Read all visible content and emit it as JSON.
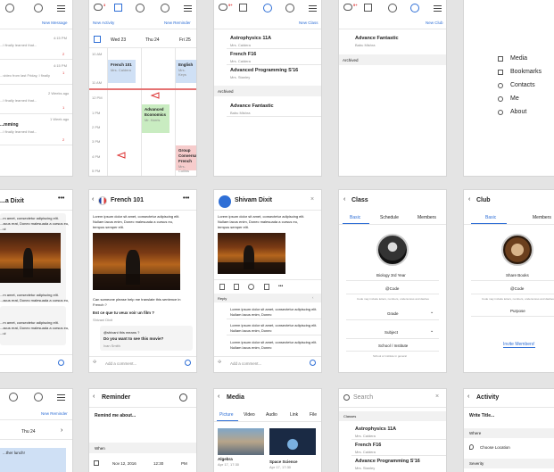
{
  "row1": {
    "s1": {
      "new_message": "New Message",
      "rows": [
        {
          "time": "4:15 PM",
          "text": "...I finally learned that...",
          "count": "2"
        },
        {
          "time": "4:15 PM",
          "text": "",
          "count": "1"
        },
        {
          "time": "",
          "text": "...video from last Friday, I finally",
          "count": ""
        },
        {
          "time": "2 Weeks ago",
          "text": "...I finally learned that...",
          "count": "1"
        },
        {
          "time": "1 Week ago",
          "title": "...mming",
          "text": "...I finally learned that...",
          "count": "2"
        }
      ]
    },
    "s2": {
      "new_activity": "New Activity",
      "new_reminder": "New Reminder",
      "badge": "3",
      "days": [
        "Wed 23",
        "Thu 24",
        "Fri 25"
      ],
      "times": [
        "10 AM",
        "11 AM",
        "12 PM",
        "1 PM",
        "2 PM",
        "3 PM",
        "4 PM",
        "5 PM"
      ],
      "events": [
        {
          "title": "French 101",
          "sub": "Mrs. Caldera"
        },
        {
          "title": "English",
          "sub": "Mrs. Keys"
        },
        {
          "title": "Advanced Economics",
          "sub": "Mr. Harris"
        },
        {
          "title": "Group Conversation French",
          "sub": "Mrs. Collins"
        }
      ]
    },
    "s3": {
      "new_class": "New Class",
      "badge": "9+",
      "classes": [
        {
          "name": "Astrophysics 11A",
          "teacher": "Mrs. Caldera"
        },
        {
          "name": "French F16",
          "teacher": "Mrs. Caldera"
        },
        {
          "name": "Advanced Programming S'16",
          "teacher": "Mrs. Stanley"
        }
      ],
      "archived": "Archived",
      "archived_items": [
        {
          "name": "Advance Fantastic",
          "teacher": "Babu Mishra"
        }
      ]
    },
    "s4": {
      "new_club": "New Club",
      "badge": "9+",
      "clubs": [
        {
          "name": "Advance Fantastic",
          "teacher": "Babu Mishra"
        }
      ],
      "archived": "Archived"
    },
    "s5": {
      "menu": [
        "Media",
        "Bookmarks",
        "Contacts",
        "Me",
        "About"
      ]
    }
  },
  "row2": {
    "s1": {
      "title": "...a Dixit",
      "lines": [
        "...m amet, consectetur adipiscing elit.",
        "...acus erat, Donec malesuada a cursus eu,",
        "...ui",
        "...m amet, consectetur adipiscing elit.",
        "...acus erat, Donec malesuada a cursus eu,",
        "...m amet, consectetur adipiscing elit.",
        "...acus erat, Donec malesuada a cursus eu,",
        "...ui"
      ]
    },
    "s2": {
      "title": "French 101",
      "post": [
        "Lorem ipsum dolor sit amet, consectetur adipiscing elit.",
        "Nullam lacus enim, Donec malesuada a cursus eu,",
        "tempus semper elit."
      ],
      "question": [
        "Can someone please help me translate this sentence in",
        "French ?"
      ],
      "q_bold": "Est ce que tu veux voir un film ?",
      "q_author": "Shivani Dixit",
      "reply": [
        "@shivani this means ?",
        "Do you want to see this movie?"
      ],
      "reply_author": "Ivan Smith",
      "comment_placeholder": "Add a comment..."
    },
    "s3": {
      "title": "Shivam Dixit",
      "post": [
        "Lorem ipsum dolor sit amet, consectetur adipiscing elit.",
        "Nullam lacus enim, Donec malesuada a cursus eu,",
        "tempus semper elit."
      ],
      "reply_label": "Reply",
      "replies": [
        [
          "Lorem ipsum dolor sit amet, consectetur adipiscing elit.",
          "Nullam lacus enim, Donec"
        ],
        [
          "Lorem ipsum dolor sit amet, consectetur adipiscing elit.",
          "Nullam lacus enim, Donec"
        ],
        [
          "Lorem ipsum dolor sit amet, consectetur adipiscing elit.",
          "Nullam lacus enim, Donec"
        ]
      ],
      "comment_placeholder": "Add a comment..."
    },
    "s4": {
      "title": "Class",
      "tabs": [
        "Basic",
        "Schedule",
        "Members"
      ],
      "name": "Biology 3rd Year",
      "code": "@Code",
      "code_hint": "Code may include letters, numbers, underscores and dashes",
      "grade": "Grade",
      "subject": "Subject",
      "school": "School / Institute",
      "school_hint": "School or institute in general"
    },
    "s5": {
      "title": "Club",
      "tabs": [
        "Basic",
        "Members"
      ],
      "name": "Share Books",
      "code": "@Code",
      "code_hint": "Code may include letters, numbers, underscores and dashes",
      "purpose": "Purpose",
      "invite": "Invite Members!"
    }
  },
  "row3": {
    "s1": {
      "new_reminder": "New Reminder",
      "day": "Thu 24",
      "event": "...ther lunch!"
    },
    "s2": {
      "title": "Reminder",
      "prompt": "Remind me about...",
      "when": "When",
      "date": "Nov 12, 2016",
      "time": "12:30",
      "ampm": "PM"
    },
    "s3": {
      "title": "Media",
      "tabs": [
        "Picture",
        "Video",
        "Audio",
        "Link",
        "File"
      ],
      "items": [
        {
          "name": "Algebra",
          "date": "Apr 17, 17:30"
        },
        {
          "name": "Space Science",
          "date": "Apr 17, 17:30"
        }
      ]
    },
    "s4": {
      "search_placeholder": "Search",
      "section": "Classes",
      "results": [
        {
          "name": "Astrophysics 11A",
          "teacher": "Mrs. Caldera"
        },
        {
          "name": "French F16",
          "teacher": "Mrs. Caldera"
        },
        {
          "name": "Advance Programming S'16",
          "teacher": "Mrs. Stanley"
        }
      ]
    },
    "s5": {
      "title": "Activity",
      "write_title": "Write Title...",
      "where": "Where",
      "location": "Choose Location",
      "severity": "Severity"
    }
  },
  "colors": {
    "accent": "#2f6fd6",
    "red": "#dd3333",
    "blue_event": "#cfe0f5",
    "green_event": "#c9ecc1",
    "red_event": "#f6cccc",
    "club_tab": "#2f6fd6"
  }
}
